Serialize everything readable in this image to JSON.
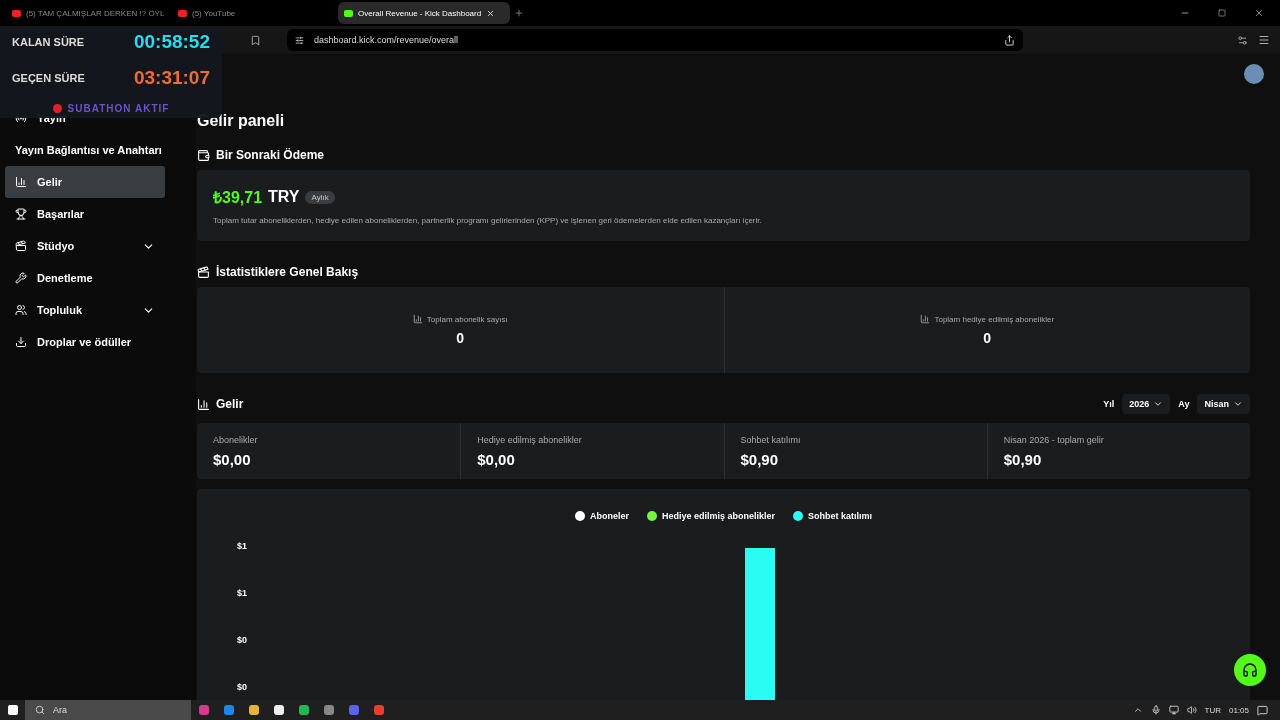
{
  "browser": {
    "tabs": [
      {
        "title": "(5) TAM ÇALMIŞLAR DERKEN !? ÖYL",
        "selected": false
      },
      {
        "title": "(5) YouTube",
        "selected": false
      },
      {
        "title": "Overall Revenue - Kick Dashboard",
        "selected": true
      }
    ],
    "url": "dashboard.kick.com/revenue/overall"
  },
  "stream_overlay": {
    "remaining_label": "KALAN SÜRE",
    "remaining": "00:58:52",
    "elapsed_label": "GEÇEN SÜRE",
    "elapsed": "03:31:07",
    "status": "SUBATHON AKTIF"
  },
  "sidebar": {
    "items": [
      {
        "label": "Yayın",
        "kind": "live",
        "selected": false,
        "expandable": false
      },
      {
        "label": "Yayın Bağlantısı ve Anahtarı",
        "kind": "sub",
        "selected": false,
        "expandable": false
      },
      {
        "label": "Gelir",
        "kind": "chart",
        "selected": true,
        "expandable": false
      },
      {
        "label": "Başarılar",
        "kind": "trophy",
        "selected": false,
        "expandable": false
      },
      {
        "label": "Stüdyo",
        "kind": "studio",
        "selected": false,
        "expandable": true
      },
      {
        "label": "Denetleme",
        "kind": "wrench",
        "selected": false,
        "expandable": false
      },
      {
        "label": "Topluluk",
        "kind": "people",
        "selected": false,
        "expandable": true
      },
      {
        "label": "Droplar ve ödüller",
        "kind": "drop",
        "selected": false,
        "expandable": false
      }
    ]
  },
  "page": {
    "title": "Gelir paneli",
    "next_payment": {
      "heading": "Bir Sonraki Ödeme",
      "amount": "₺39,71",
      "currency": "TRY",
      "period": "Aylık",
      "note": "Toplam tutar aboneliklerden, hediye edilen aboneliklerden, partnerlik programı gelirlerinden (KPP) ve işlenen geri ödemelerden elde edilen kazançları içerir."
    },
    "overview": {
      "heading": "İstatistiklere Genel Bakış",
      "stats": [
        {
          "label": "Toplam abonelik sayısı",
          "value": "0"
        },
        {
          "label": "Toplam hediye edilmiş abonelikler",
          "value": "0"
        }
      ]
    },
    "revenue": {
      "heading": "Gelir",
      "year_label": "Yıl",
      "year": "2026",
      "month_label": "Ay",
      "month": "Nisan",
      "cards": [
        {
          "label": "Abonelikler",
          "value": "$0,00"
        },
        {
          "label": "Hediye edilmiş abonelikler",
          "value": "$0,00"
        },
        {
          "label": "Sohbet katılımı",
          "value": "$0,90"
        },
        {
          "label": "Nisan 2026 - toplam gelir",
          "value": "$0,90"
        }
      ],
      "legend": [
        {
          "name": "Aboneler",
          "color": "#ffffff"
        },
        {
          "name": "Hediye edilmiş abonelikler",
          "color": "#75f542"
        },
        {
          "name": "Sohbet katılımı",
          "color": "#2afcf4"
        }
      ],
      "y_axis_labels": [
        "$1",
        "$1",
        "$0",
        "$0"
      ]
    }
  },
  "taskbar": {
    "search_placeholder": "Ara",
    "language": "TUR",
    "time": "01:05"
  }
}
